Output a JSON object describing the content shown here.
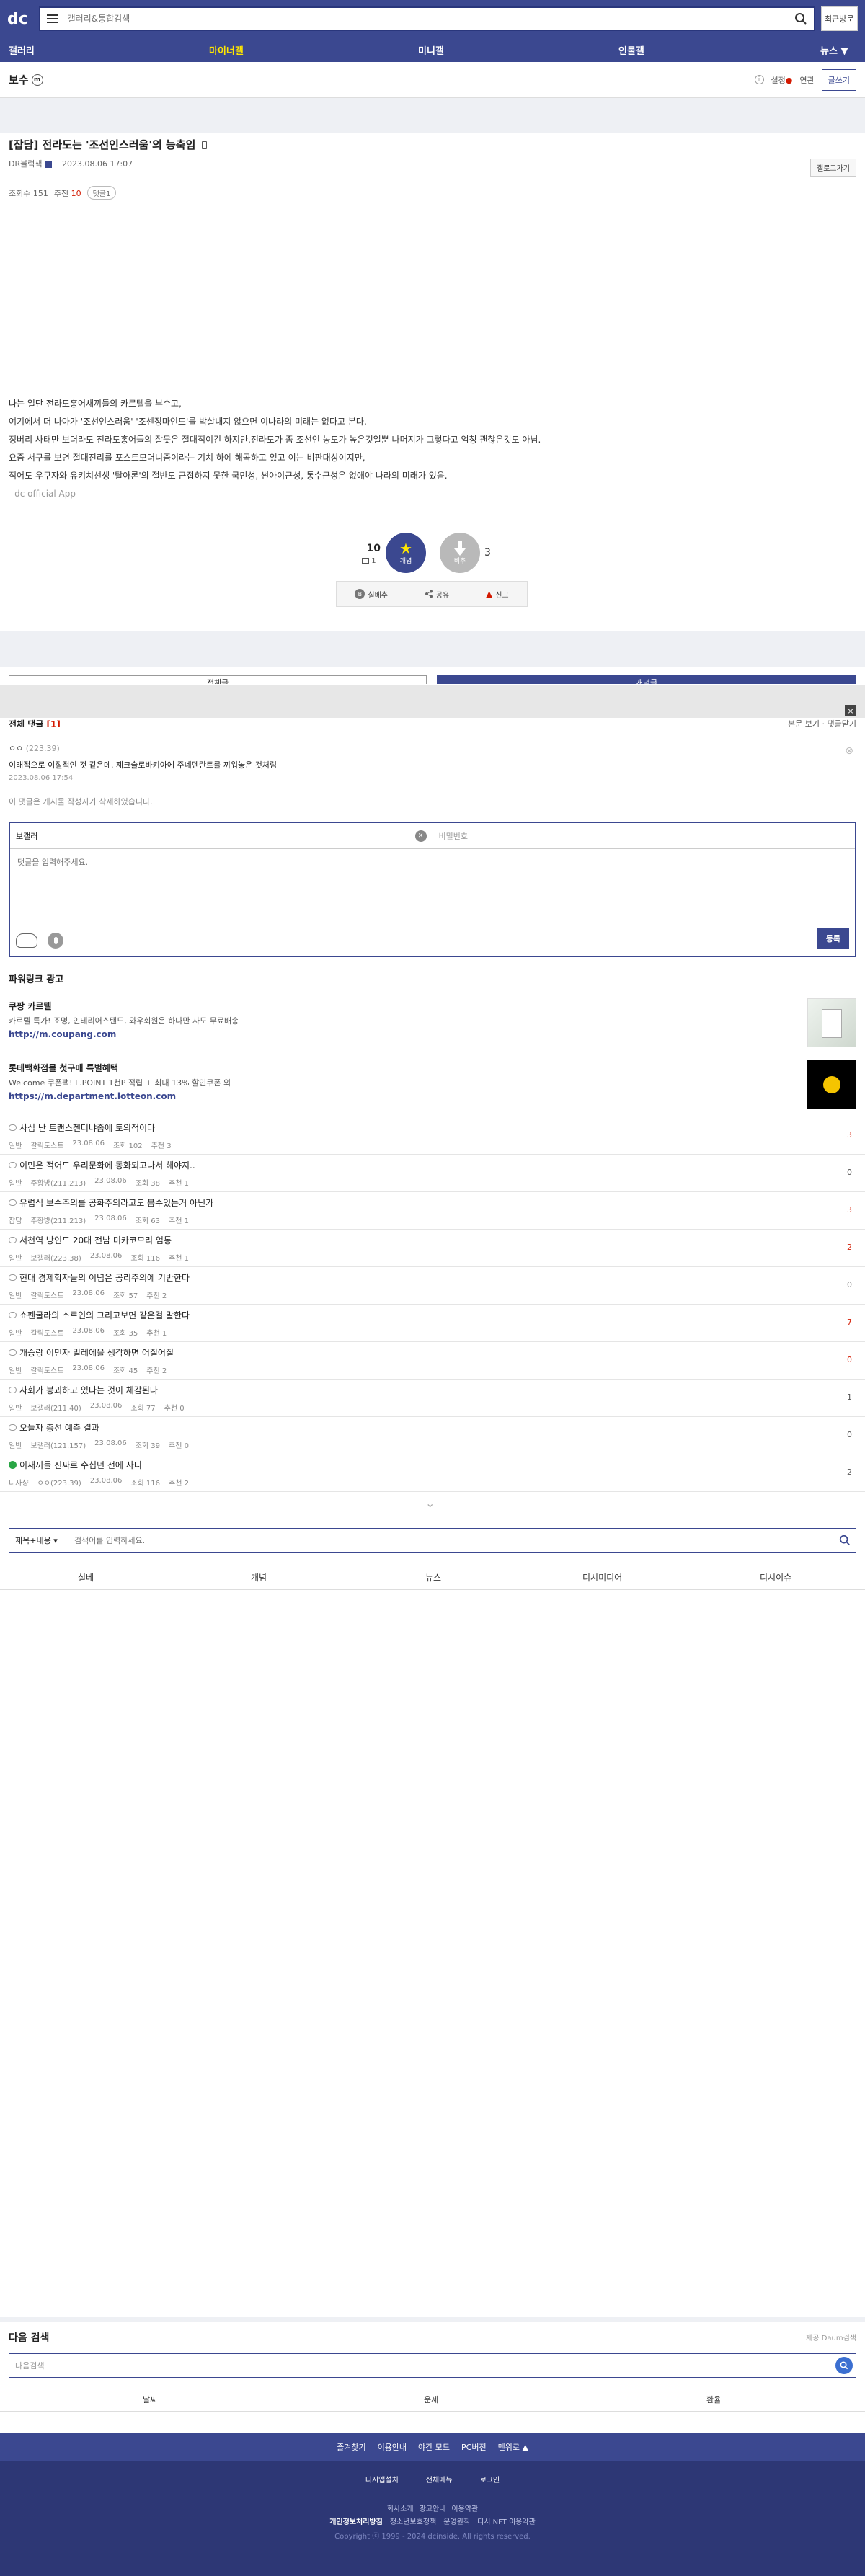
{
  "header": {
    "logo_text": "dc",
    "search_placeholder": "갤러리&통합검색",
    "recent_label": "최근방문"
  },
  "gnb": {
    "items": [
      {
        "label": "갤러리"
      },
      {
        "label": "마이너갤"
      },
      {
        "label": "미니갤"
      },
      {
        "label": "인물갤"
      },
      {
        "label": "뉴스 ▼"
      }
    ]
  },
  "gallery": {
    "title": "보수",
    "badge": "m",
    "setting_label": "설정",
    "related_label": "연관",
    "write_label": "글쓰기"
  },
  "post": {
    "head_prefix": "[",
    "category": "잡담",
    "title": "] 전라도는 '조선인스러움'의 능축임",
    "author": "DR블럭책",
    "date": "2023.08.06 17:07",
    "goto_list": "갤로그가기",
    "views_label": "조회수 151",
    "recommend_label": "추천",
    "recommend_count": "10",
    "comment_pill": "댓글1",
    "body": [
      "나는 일단 전라도홍어새끼들의 카르텔을 부수고,",
      "여기에서 더 나아가 '조선인스러움' '조센징마인드'를 박살내지 않으면 이나라의 미래는 없다고 본다.",
      "정버리 사태만 보더라도 전라도홍어들의 잘못은 절대적이긴 하지만,전라도가 좀 조선인 농도가 높은것일뿐 나머지가 그렇다고 엄청 괜찮은것도 아님.",
      "요즘 서구를 보면 절대진리를 포스트모더니즘이라는 기치 하에 해곡하고 있고 이는 비판대상이지만,",
      "적어도 우쿠자와 유키치선생 '탈아론'의 절반도 근접하지 못한 국민성,  썬아이근성, 통수근성은 없애야 나라의 미래가 있음."
    ],
    "app_sig": "- dc official App",
    "up_count": "10",
    "up_sub": "1",
    "up_label": "개념",
    "down_label": "비추",
    "down_count": "3",
    "share": [
      {
        "label": "실베추"
      },
      {
        "label": "공유"
      },
      {
        "label": "신고"
      }
    ]
  },
  "buttons": {
    "list_label": "전체글",
    "featured_label": "개념글"
  },
  "comments": {
    "title": "전체 댓글",
    "count": "[1]",
    "sort_label": "본문 보기",
    "close_label": "댓글닫기",
    "items": [
      {
        "nick": "ㅇㅇ",
        "ip": "(223.39)",
        "text": "이래적으로 이질적인 것 같은데. 제크술로바키아에 주네덴란트를 끼워놓은 것처럼",
        "date": "2023.08.06 17:54"
      }
    ],
    "deleted_notice": "이 댓글은 게시물 작성자가 삭제하였습니다.",
    "form": {
      "nick_value": "보갤러",
      "password_placeholder": "비밀번호",
      "body_placeholder": "댓글을 입력해주세요.",
      "submit_label": "등록"
    }
  },
  "ads": {
    "title": "파워링크 광고",
    "items": [
      {
        "title": "쿠팡 카르텔",
        "desc": "카르텔 특가! 조명, 인테리어스탠드, 와우회원은 하나만 사도 무료배송",
        "url": "http://m.coupang.com",
        "color": "#ffffff"
      },
      {
        "title": "롯데백화점몰 첫구매 특별혜택",
        "desc": "Welcome 쿠폰팩! L.POINT 1천P 적립 + 최대 13% 할인쿠폰 외",
        "url": "https://m.department.lotteon.com",
        "color": "#000000"
      }
    ]
  },
  "post_list": [
    {
      "title": "사심 난 트랜스젠더냐좀에 토의적이다",
      "cat": "일반",
      "author": "갈릭도스트",
      "date": "23.08.06",
      "views": "조회 102",
      "rec": "추천 3",
      "comments": "3",
      "hot": true
    },
    {
      "title": "이민은 적어도 우리문화에 동화되고나서 해야지..",
      "cat": "일반",
      "author": "주황방(211.213)",
      "date": "23.08.06",
      "views": "조회 38",
      "rec": "추천 1",
      "comments": "0",
      "hot": false
    },
    {
      "title": "유럽식 보수주의를 공화주의라고도 봄수있는거 아닌가",
      "cat": "잡담",
      "author": "주황방(211.213)",
      "date": "23.08.06",
      "views": "조회 63",
      "rec": "추천 1",
      "comments": "3",
      "hot": true
    },
    {
      "title": "서천역 방인도 20대 전남 미카코모리 엄통",
      "cat": "일반",
      "author": "보갤러(223.38)",
      "date": "23.08.06",
      "views": "조회 116",
      "rec": "추천 1",
      "comments": "2",
      "hot": true
    },
    {
      "title": "현대 경제학자들의 이념은 공리주의에 기반한다",
      "cat": "일반",
      "author": "갈릭도스트",
      "date": "23.08.06",
      "views": "조회 57",
      "rec": "추천 2",
      "comments": "0",
      "hot": false
    },
    {
      "title": "쇼펜굴라의 소로인의 그리고보면 같은걸 말한다",
      "cat": "일반",
      "author": "갈릭도스트",
      "date": "23.08.06",
      "views": "조회 35",
      "rec": "추천 1",
      "comments": "7",
      "hot": true
    },
    {
      "title": "개승랑 이민자 밀레에을 생각하면 어질어질",
      "cat": "일반",
      "author": "갈릭도스트",
      "date": "23.08.06",
      "views": "조회 45",
      "rec": "추천 2",
      "comments": "0",
      "hot": true
    },
    {
      "title": "사회가 붕괴하고 있다는 것이 체감된다",
      "cat": "일반",
      "author": "보갤러(211.40)",
      "date": "23.08.06",
      "views": "조회 77",
      "rec": "추천 0",
      "comments": "1",
      "hot": false
    },
    {
      "title": "오늘자 총선 예측 결과",
      "cat": "일반",
      "author": "보갤러(121.157)",
      "date": "23.08.06",
      "views": "조회 39",
      "rec": "추천 0",
      "comments": "0",
      "hot": false
    },
    {
      "title": "이새끼들 진짜로 수십년 전에 사니",
      "cat": "디자샹",
      "author": "ㅇㅇ(223.39)",
      "date": "23.08.06",
      "views": "조회 116",
      "rec": "추천 2",
      "comments": "2",
      "hot": false
    }
  ],
  "board_search": {
    "select_label": "제목+내용 ▾",
    "placeholder": "검색어를 입력하세요."
  },
  "bottom_tabs": [
    {
      "label": "실베"
    },
    {
      "label": "개념"
    },
    {
      "label": "뉴스"
    },
    {
      "label": "디시미디어"
    },
    {
      "label": "디시이슈"
    }
  ],
  "next_search": {
    "title": "다음 검색",
    "provider": "제공 Daum검색",
    "placeholder": "다음검색",
    "keywords": [
      {
        "label": "날씨"
      },
      {
        "label": "운세"
      },
      {
        "label": "환율"
      }
    ]
  },
  "footer": {
    "top_links": [
      {
        "label": "즐겨찾기"
      },
      {
        "label": "이용안내"
      },
      {
        "label": "야간 모드"
      },
      {
        "label": "PC버전"
      },
      {
        "label": "맨위로 ▲"
      }
    ],
    "row1": [
      {
        "label": "디시앱설치"
      },
      {
        "label": "전체메뉴"
      },
      {
        "label": "로그인"
      }
    ],
    "row2": [
      {
        "label": "회사소개"
      },
      {
        "label": "광고안내"
      },
      {
        "label": "이용약관"
      }
    ],
    "row3": [
      {
        "label": "개인정보처리방침"
      },
      {
        "label": "청소년보호정책"
      },
      {
        "label": "운영원칙"
      },
      {
        "label": "디시 NFT 이용약관"
      }
    ],
    "copyright": "Copyright ⓒ 1999 - 2024 dcinside. All rights reserved."
  }
}
